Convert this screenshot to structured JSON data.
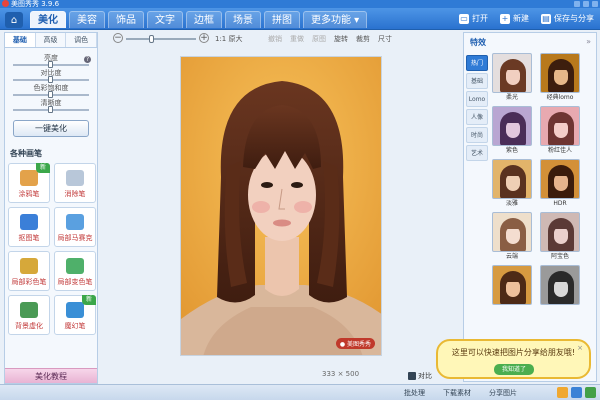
{
  "window": {
    "title": "美图秀秀 3.9.6"
  },
  "menu": {
    "tabs": [
      "美化",
      "美容",
      "饰品",
      "文字",
      "边框",
      "场景",
      "拼图",
      "更多功能 ▾"
    ],
    "active_index": 0,
    "right": {
      "open": "打开",
      "new": "新建",
      "save_share": "保存与分享"
    }
  },
  "toolbar": {
    "original_size": "1:1 原大",
    "zoom_level": 0.35,
    "tools": [
      "撤销",
      "重做",
      "原图",
      "旋转",
      "裁剪",
      "尺寸"
    ],
    "disabled_tools": [
      0,
      1,
      2
    ]
  },
  "left_panel": {
    "tabs": [
      "基础",
      "高级",
      "调色"
    ],
    "sliders": [
      {
        "label": "亮度",
        "value": 0.5
      },
      {
        "label": "对比度",
        "value": 0.5
      },
      {
        "label": "色彩饱和度",
        "value": 0.5
      },
      {
        "label": "清晰度",
        "value": 0.5
      }
    ],
    "one_click_button": "一键美化",
    "pens_title": "各种画笔",
    "pens": [
      {
        "label": "涂鸦笔",
        "color": "#e3a24a",
        "is_new": true
      },
      {
        "label": "消除笔",
        "color": "#b8c7d9",
        "is_new": false
      },
      {
        "label": "抠图笔",
        "color": "#3b7fd8",
        "is_new": false
      },
      {
        "label": "局部马赛克",
        "color": "#5aa0e0",
        "is_new": false
      },
      {
        "label": "局部彩色笔",
        "color": "#d6a83a",
        "is_new": false
      },
      {
        "label": "局部变色笔",
        "color": "#4fb06a",
        "is_new": false
      },
      {
        "label": "背景虚化",
        "color": "#4a9a55",
        "is_new": false
      },
      {
        "label": "魔幻笔",
        "color": "#3a8fd6",
        "is_new": true
      }
    ],
    "new_badge": "新",
    "tutorial": "美化教程"
  },
  "canvas": {
    "dimensions": "333 × 500",
    "compare": "对比"
  },
  "right_panel": {
    "title": "特效",
    "categories": [
      "热门",
      "基础",
      "Lomo",
      "人像",
      "时尚",
      "艺术"
    ],
    "effects": [
      {
        "label": "柔光",
        "bg": "#e4dede",
        "hair": "#6b3a24",
        "face": "#f1cfc0"
      },
      {
        "label": "经典lomo",
        "bg": "#b8791c",
        "hair": "#3d1e0e",
        "face": "#e7b889"
      },
      {
        "label": "紫色",
        "bg": "#b9a6d2",
        "hair": "#4a2d58",
        "face": "#e2c7dd"
      },
      {
        "label": "粉红佳人",
        "bg": "#e8a9b0",
        "hair": "#6e3432",
        "face": "#f4cdc9"
      },
      {
        "label": "淡雅",
        "bg": "#e2b46a",
        "hair": "#5a3220",
        "face": "#efcfb5"
      },
      {
        "label": "HDR",
        "bg": "#d39038",
        "hair": "#3c1c0c",
        "face": "#e7b48d"
      },
      {
        "label": "云端",
        "bg": "#eedfcb",
        "hair": "#8a5e44",
        "face": "#f4ddd0"
      },
      {
        "label": "阿宝色",
        "bg": "#cfb9b4",
        "hair": "#5b3a36",
        "face": "#ead0cc"
      },
      {
        "label": "",
        "bg": "#d69a40",
        "hair": "#4d2a16",
        "face": "#eec19c"
      },
      {
        "label": "",
        "bg": "#9a9a9a",
        "hair": "#2a2a2a",
        "face": "#d8d8d8"
      }
    ]
  },
  "toast": {
    "text": "这里可以快速把图片分享给朋友哦!",
    "button": "我知道了"
  },
  "status": {
    "batch": "批处理",
    "download": "下载素材",
    "share": "分享图片"
  }
}
